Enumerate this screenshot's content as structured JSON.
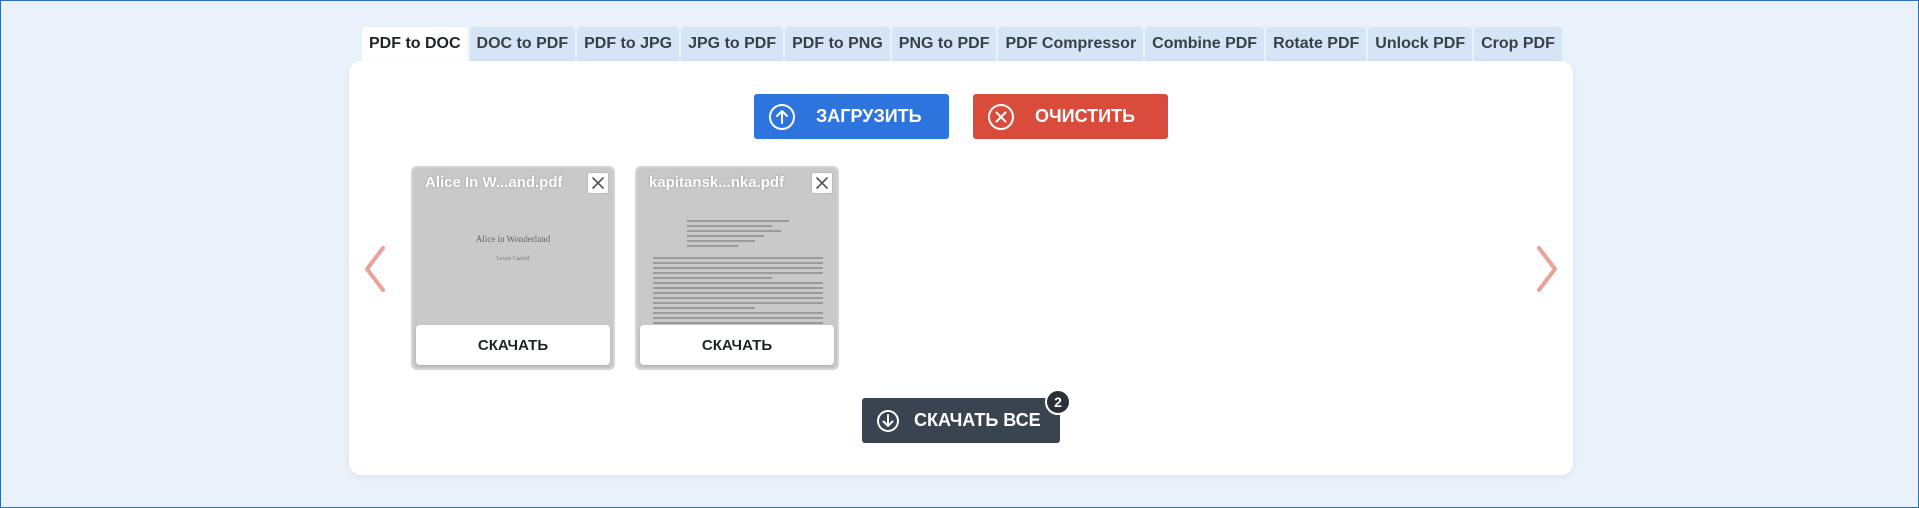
{
  "tabs": [
    {
      "label": "PDF to DOC",
      "active": true
    },
    {
      "label": "DOC to PDF"
    },
    {
      "label": "PDF to JPG"
    },
    {
      "label": "JPG to PDF"
    },
    {
      "label": "PDF to PNG"
    },
    {
      "label": "PNG to PDF"
    },
    {
      "label": "PDF Compressor"
    },
    {
      "label": "Combine PDF"
    },
    {
      "label": "Rotate PDF"
    },
    {
      "label": "Unlock PDF"
    },
    {
      "label": "Crop PDF"
    }
  ],
  "actions": {
    "upload_label": "ЗАГРУЗИТЬ",
    "upload_icon": "arrow-up-circle-icon",
    "clear_label": "ОЧИСТИТЬ",
    "clear_icon": "x-circle-icon"
  },
  "files": [
    {
      "name": "Alice In W...and.pdf",
      "thumb_title": "Alice in Wonderland",
      "thumb_author": "Lewis Carroll",
      "download_label": "СКАЧАТЬ"
    },
    {
      "name": "kapitansk...nka.pdf",
      "download_label": "СКАЧАТЬ"
    }
  ],
  "download_all": {
    "label": "СКАЧАТЬ ВСЕ",
    "count": "2",
    "icon": "arrow-down-circle-icon"
  },
  "colors": {
    "upload": "#2e74de",
    "clear": "#d94b3b",
    "download_all": "#3a4450",
    "arrows": "#e8a298",
    "tab_bg": "#d5e5f6",
    "page_bg": "#e9f1fa"
  }
}
